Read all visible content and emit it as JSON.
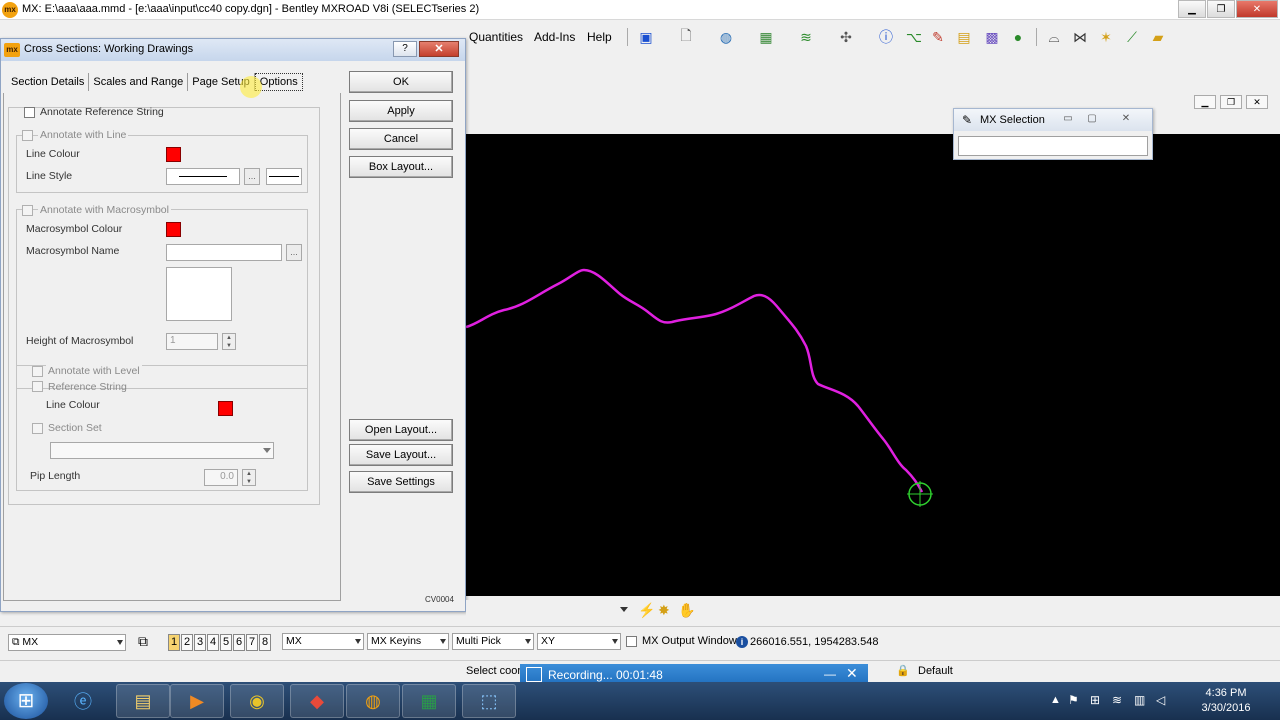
{
  "app": {
    "logo": "mx",
    "title": "MX: E:\\aaa\\aaa.mmd - [e:\\aaa\\input\\cc40 copy.dgn] - Bentley MXROAD V8i (SELECTseries 2)"
  },
  "menu": {
    "quantities": "Quantities",
    "addins": "Add-Ins",
    "help": "Help"
  },
  "dialog": {
    "logo": "mx",
    "title": "Cross Sections: Working Drawings",
    "help": "?",
    "close": "✕",
    "tabs": [
      {
        "label": "Section Details"
      },
      {
        "label": "Scales and Range"
      },
      {
        "label": "Page Setup"
      },
      {
        "label": "Options"
      }
    ],
    "annotate_reference_string": "Annotate Reference String",
    "line_group": {
      "annotate_with_line": "Annotate with Line",
      "line_colour": "Line Colour",
      "line_style": "Line Style",
      "browse": "..."
    },
    "macro_group": {
      "annotate_with_macrosymbol": "Annotate with Macrosymbol",
      "macrosymbol_colour": "Macrosymbol Colour",
      "macrosymbol_name": "Macrosymbol Name",
      "browse": "...",
      "height_label": "Height of Macrosymbol",
      "height_value": "1"
    },
    "level_group": {
      "annotate_with_level": "Annotate with Level",
      "reference_string": "Reference String",
      "line_colour": "Line Colour",
      "section_set": "Section Set",
      "pip_length_label": "Pip Length",
      "pip_length_value": "0.0"
    },
    "buttons": {
      "ok": "OK",
      "apply": "Apply",
      "cancel": "Cancel",
      "box_layout": "Box Layout...",
      "open_layout": "Open Layout...",
      "save_layout": "Save Layout...",
      "save_settings": "Save Settings"
    },
    "code": "CV0004"
  },
  "mx_selection": {
    "title": "MX Selection"
  },
  "viewport": {
    "line_color": "#e020e0",
    "cursor_color": "#2fd02f"
  },
  "statusbar": {
    "mx_combo": "MX",
    "view_numbers": [
      "1",
      "2",
      "3",
      "4",
      "5",
      "6",
      "7",
      "8"
    ],
    "active_view": "1",
    "mx_box": "MX",
    "mx_keyins": "MX Keyins",
    "multi_pick": "Multi Pick",
    "xy": "XY",
    "output_window": "MX Output Window",
    "coords": "266016.551, 1954283.548",
    "select_coord": "Select coord",
    "default": "Default"
  },
  "recording": {
    "text": "Recording... 00:01:48",
    "minimize": "—",
    "close": "✕"
  },
  "taskbar": {
    "time": "4:36 PM",
    "date": "3/30/2016"
  }
}
